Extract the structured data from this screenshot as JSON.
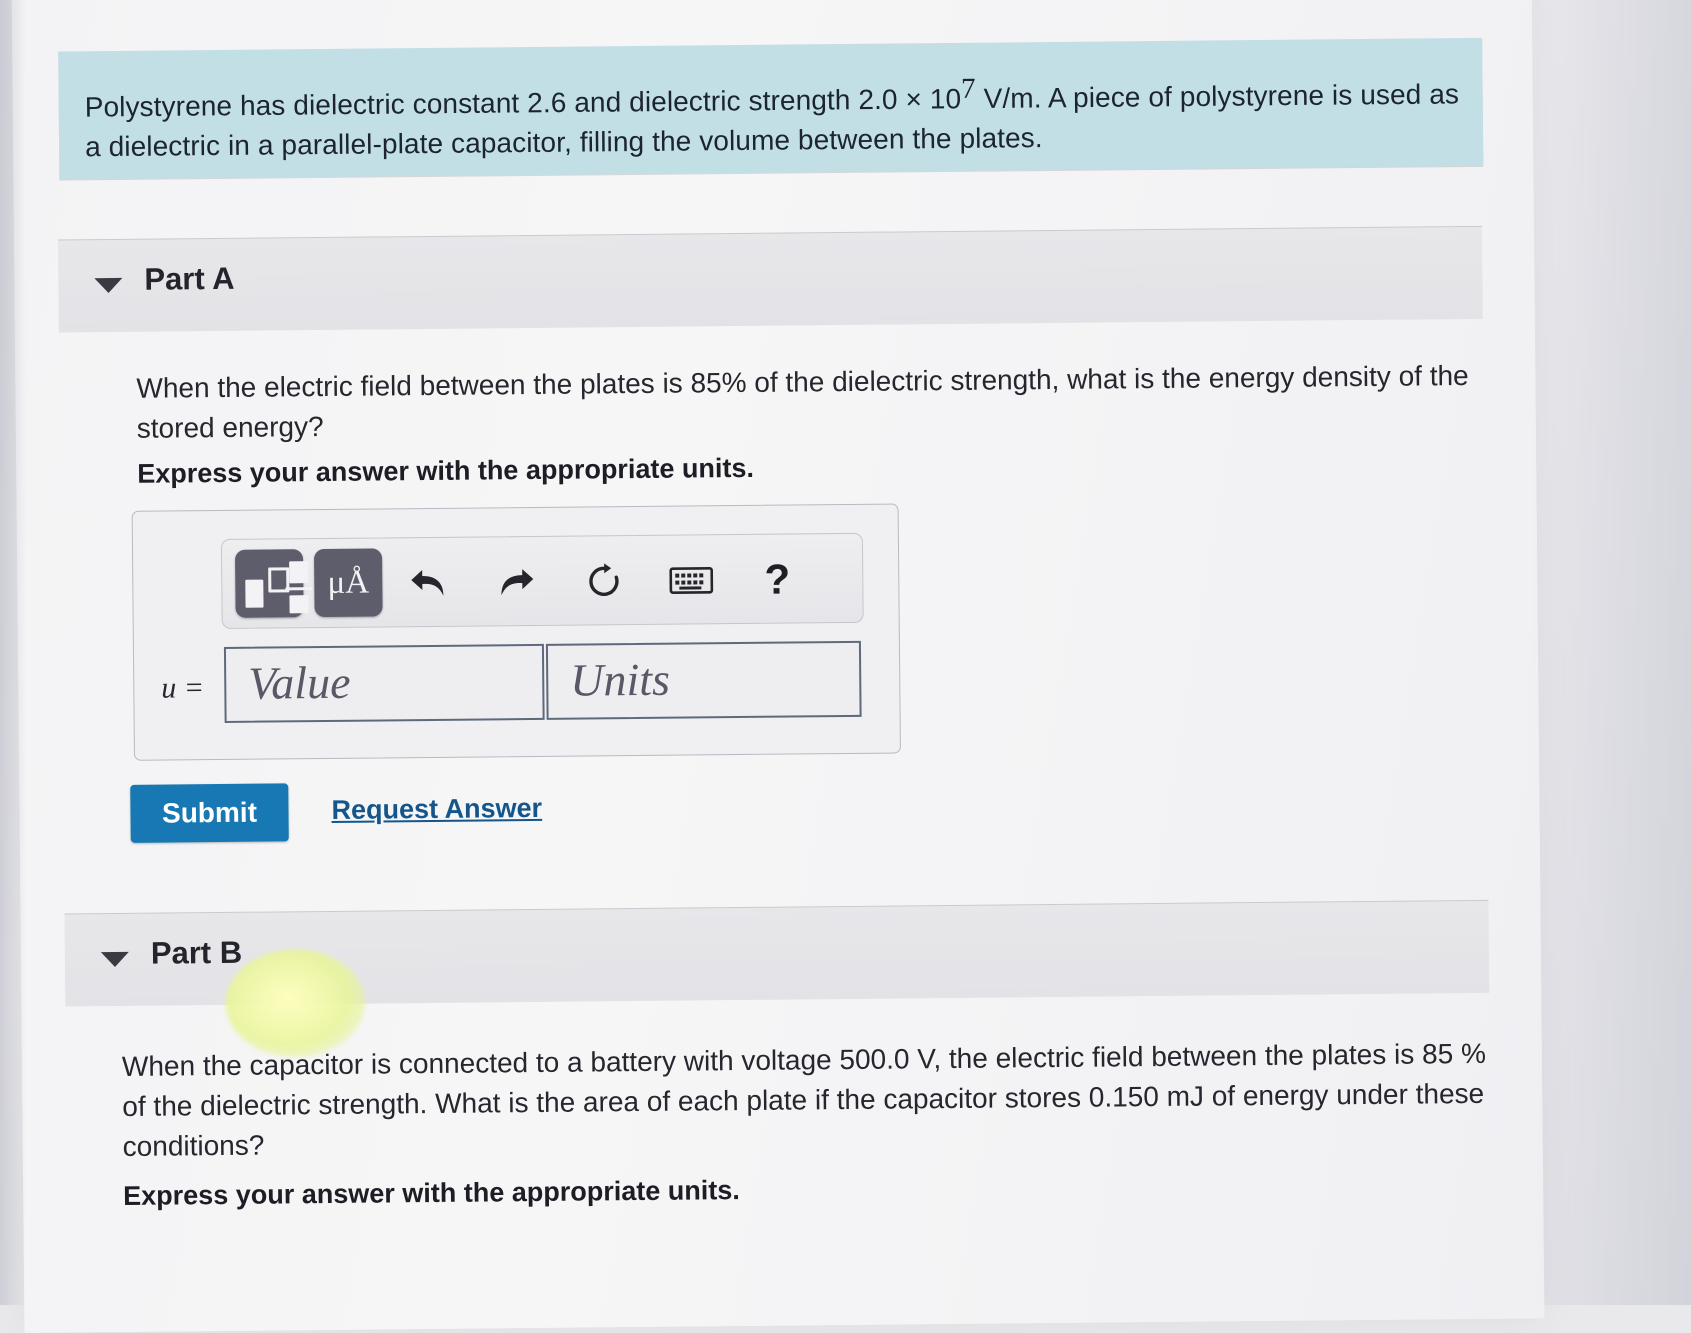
{
  "problem": {
    "text_part1": "Polystyrene has dielectric constant 2.6 and dielectric strength 2.0 × 10",
    "exponent": "7",
    "text_part2": " V/m. A piece of polystyrene is used as a dielectric in a parallel-plate capacitor, filling the volume between the plates."
  },
  "parts": [
    {
      "id": "A",
      "header_label": "Part A",
      "caret_icon": "triangle-down-icon",
      "question": "When the electric field between the plates is 85% of the dielectric strength, what is the energy density of the stored energy?",
      "instruction": "Express your answer with the appropriate units.",
      "answer_widget": {
        "equation_label": "u =",
        "value_placeholder": "Value",
        "units_placeholder": "Units",
        "toolbar": [
          {
            "name": "template-button",
            "label": ""
          },
          {
            "name": "units-button",
            "label": "μÅ"
          },
          {
            "name": "undo-button",
            "label": ""
          },
          {
            "name": "redo-button",
            "label": ""
          },
          {
            "name": "reset-button",
            "label": ""
          },
          {
            "name": "keyboard-button",
            "label": ""
          },
          {
            "name": "help-button",
            "label": "?"
          }
        ]
      },
      "submit_label": "Submit",
      "request_answer_label": "Request Answer"
    },
    {
      "id": "B",
      "header_label": "Part B",
      "caret_icon": "triangle-down-icon",
      "question": "When the capacitor is connected to a battery with voltage 500.0 V, the electric field between the plates is 85 % of the dielectric strength. What is the area of each plate if the capacitor stores 0.150 mJ of energy under these conditions?",
      "instruction": "Express your answer with the appropriate units."
    }
  ],
  "colors": {
    "problem_box": "#c2dfe6",
    "submit_button": "#1878b4",
    "link": "#14568c",
    "part_header": "#e5e5e9",
    "field_border": "#5e6a7c"
  }
}
